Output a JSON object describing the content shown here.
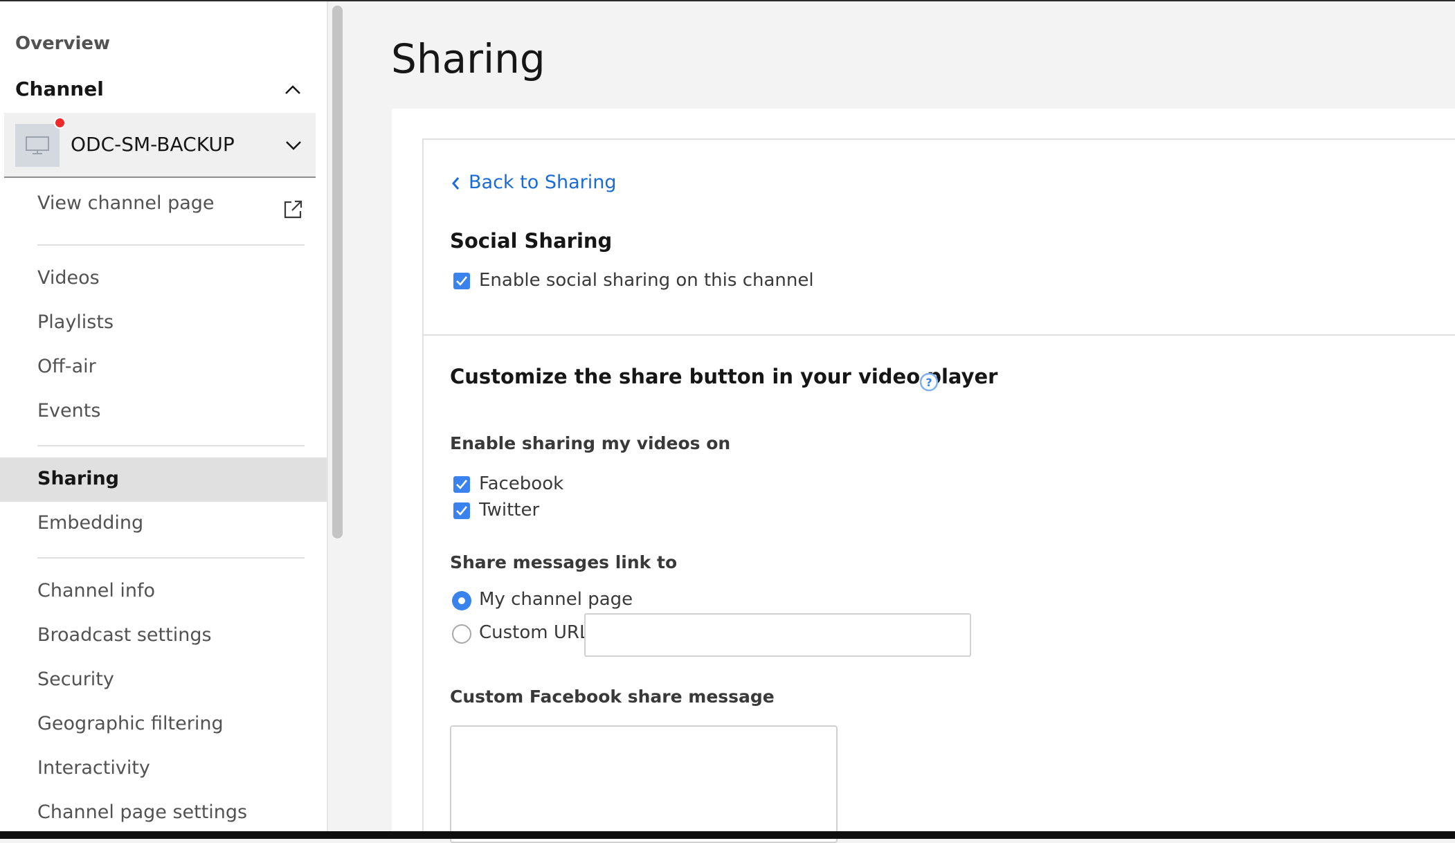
{
  "sidebar": {
    "overview_label": "Overview",
    "channel_label": "Channel",
    "channel_select": {
      "name": "ODC-SM-BACKUP",
      "live": true
    },
    "view_channel_page": "View channel page",
    "group1": [
      "Videos",
      "Playlists",
      "Off-air",
      "Events"
    ],
    "group2": [
      "Sharing",
      "Embedding"
    ],
    "group3": [
      "Channel info",
      "Broadcast settings",
      "Security",
      "Geographic filtering",
      "Interactivity",
      "Channel page settings"
    ],
    "active_item": "Sharing"
  },
  "main": {
    "page_title": "Sharing",
    "back_link": "Back to Sharing",
    "social": {
      "heading": "Social Sharing",
      "enable_label": "Enable social sharing on this channel",
      "enabled": true
    },
    "customize": {
      "heading": "Customize the share button in your video player",
      "enable_on_label": "Enable sharing my videos on",
      "networks": [
        {
          "label": "Facebook",
          "checked": true
        },
        {
          "label": "Twitter",
          "checked": true
        }
      ],
      "link_to_label": "Share messages link to",
      "link_options": [
        {
          "label": "My channel page",
          "selected": true
        },
        {
          "label": "Custom URL",
          "selected": false
        }
      ],
      "custom_url_value": "",
      "fb_message_label": "Custom Facebook share message",
      "fb_message_value": ""
    }
  },
  "colors": {
    "accent": "#3a82ee",
    "link": "#1b6bd6",
    "live_dot": "#ee2b2b"
  }
}
